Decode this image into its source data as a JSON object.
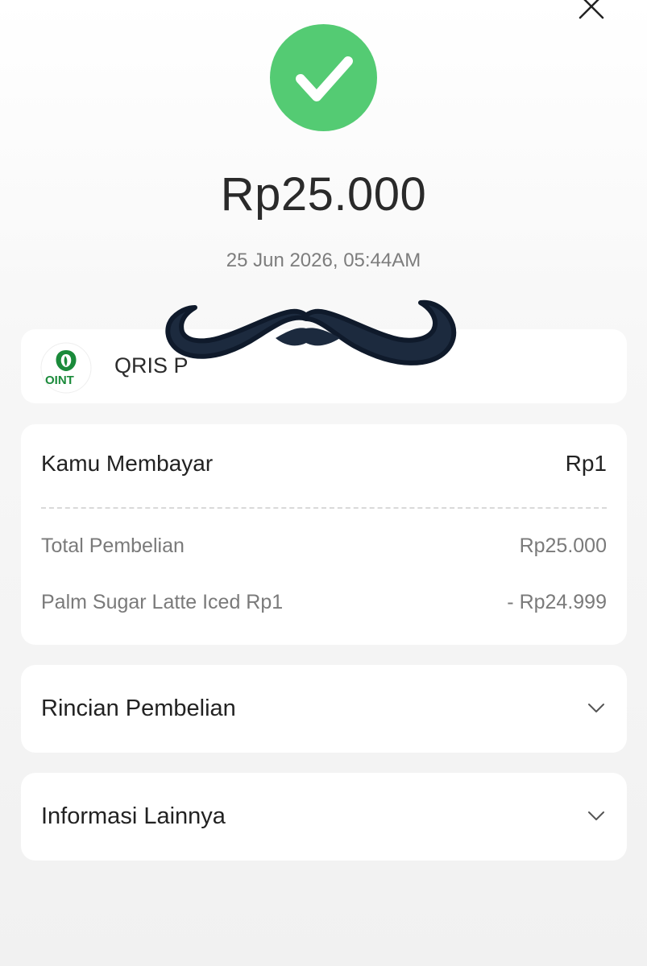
{
  "header": {
    "close_icon": "close-icon",
    "status_icon": "check-circle-icon",
    "status_color": "#54cb73"
  },
  "transaction": {
    "amount": "Rp25.000",
    "datetime": "25 Jun 2026, 05:44AM"
  },
  "merchant": {
    "logo_icon": "merchant-logo",
    "name": "QRIS P",
    "brand_color": "#1a8a3a"
  },
  "payment": {
    "you_pay_label": "Kamu Membayar",
    "you_pay_value": "Rp1",
    "total_label": "Total Pembelian",
    "total_value": "Rp25.000",
    "discount_label": "Palm Sugar Latte Iced Rp1",
    "discount_value": "- Rp24.999"
  },
  "sections": [
    {
      "label": "Rincian Pembelian",
      "icon": "chevron-down-icon"
    },
    {
      "label": "Informasi Lainnya",
      "icon": "chevron-down-icon"
    }
  ]
}
